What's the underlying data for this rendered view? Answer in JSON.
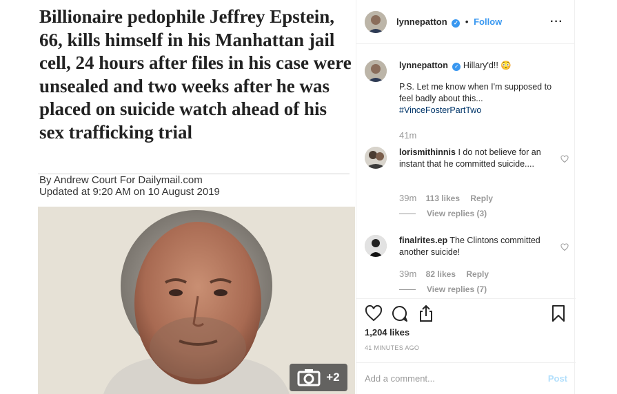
{
  "article": {
    "headline": "Billionaire pedophile Jeffrey Epstein, 66, kills himself in his Manhattan jail cell, 24 hours after files in his case were unsealed and two weeks after he was placed on suicide watch ahead of his sex trafficking trial",
    "byline": "By Andrew Court For Dailymail.com",
    "updated": "Updated at 9:20 AM on 10 August 2019",
    "carousel_count": "+2"
  },
  "header": {
    "username": "lynnepatton",
    "separator": "•",
    "follow_label": "Follow",
    "more_label": "···"
  },
  "caption": {
    "username": "lynnepatton",
    "text": "Hillary'd!! 😳",
    "line2": "P.S. Let me know when I'm supposed to feel badly about this...",
    "hashtag": "#VinceFosterPartTwo",
    "time": "41m"
  },
  "comments": [
    {
      "username": "lorismithinnis",
      "text": "I do not believe for an instant that he committed suicide....",
      "time": "39m",
      "likes": "113 likes",
      "reply_label": "Reply",
      "view_replies": "View replies (3)"
    },
    {
      "username": "finalrites.ep",
      "text": "The Clintons committed another suicide!",
      "time": "39m",
      "likes": "82 likes",
      "reply_label": "Reply",
      "view_replies": "View replies (7)"
    }
  ],
  "actions": {
    "likes": "1,204 likes",
    "time_ago": "41 MINUTES AGO"
  },
  "add_comment": {
    "placeholder": "Add a comment...",
    "post_label": "Post"
  },
  "colors": {
    "link_blue": "#3897f0",
    "muted": "#999999",
    "post_disabled": "#b2dffc"
  },
  "icons": [
    "heart-icon",
    "comment-icon",
    "share-icon",
    "bookmark-icon",
    "camera-icon",
    "verified-icon",
    "more-icon"
  ]
}
